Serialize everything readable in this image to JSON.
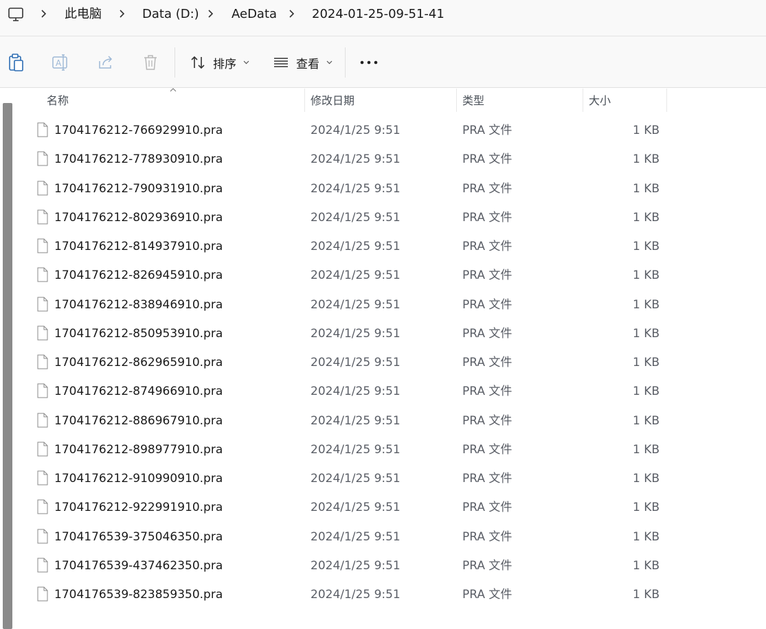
{
  "breadcrumb": {
    "items": [
      "此电脑",
      "Data (D:)",
      "AeData",
      "2024-01-25-09-51-41"
    ]
  },
  "toolbar": {
    "sort_label": "排序",
    "view_label": "查看"
  },
  "columns": {
    "name": "名称",
    "modified": "修改日期",
    "type": "类型",
    "size": "大小"
  },
  "files": [
    {
      "name": "1704176212-766929910.pra",
      "modified": "2024/1/25 9:51",
      "type": "PRA 文件",
      "size": "1 KB"
    },
    {
      "name": "1704176212-778930910.pra",
      "modified": "2024/1/25 9:51",
      "type": "PRA 文件",
      "size": "1 KB"
    },
    {
      "name": "1704176212-790931910.pra",
      "modified": "2024/1/25 9:51",
      "type": "PRA 文件",
      "size": "1 KB"
    },
    {
      "name": "1704176212-802936910.pra",
      "modified": "2024/1/25 9:51",
      "type": "PRA 文件",
      "size": "1 KB"
    },
    {
      "name": "1704176212-814937910.pra",
      "modified": "2024/1/25 9:51",
      "type": "PRA 文件",
      "size": "1 KB"
    },
    {
      "name": "1704176212-826945910.pra",
      "modified": "2024/1/25 9:51",
      "type": "PRA 文件",
      "size": "1 KB"
    },
    {
      "name": "1704176212-838946910.pra",
      "modified": "2024/1/25 9:51",
      "type": "PRA 文件",
      "size": "1 KB"
    },
    {
      "name": "1704176212-850953910.pra",
      "modified": "2024/1/25 9:51",
      "type": "PRA 文件",
      "size": "1 KB"
    },
    {
      "name": "1704176212-862965910.pra",
      "modified": "2024/1/25 9:51",
      "type": "PRA 文件",
      "size": "1 KB"
    },
    {
      "name": "1704176212-874966910.pra",
      "modified": "2024/1/25 9:51",
      "type": "PRA 文件",
      "size": "1 KB"
    },
    {
      "name": "1704176212-886967910.pra",
      "modified": "2024/1/25 9:51",
      "type": "PRA 文件",
      "size": "1 KB"
    },
    {
      "name": "1704176212-898977910.pra",
      "modified": "2024/1/25 9:51",
      "type": "PRA 文件",
      "size": "1 KB"
    },
    {
      "name": "1704176212-910990910.pra",
      "modified": "2024/1/25 9:51",
      "type": "PRA 文件",
      "size": "1 KB"
    },
    {
      "name": "1704176212-922991910.pra",
      "modified": "2024/1/25 9:51",
      "type": "PRA 文件",
      "size": "1 KB"
    },
    {
      "name": "1704176539-375046350.pra",
      "modified": "2024/1/25 9:51",
      "type": "PRA 文件",
      "size": "1 KB"
    },
    {
      "name": "1704176539-437462350.pra",
      "modified": "2024/1/25 9:51",
      "type": "PRA 文件",
      "size": "1 KB"
    },
    {
      "name": "1704176539-823859350.pra",
      "modified": "2024/1/25 9:51",
      "type": "PRA 文件",
      "size": "1 KB"
    }
  ]
}
